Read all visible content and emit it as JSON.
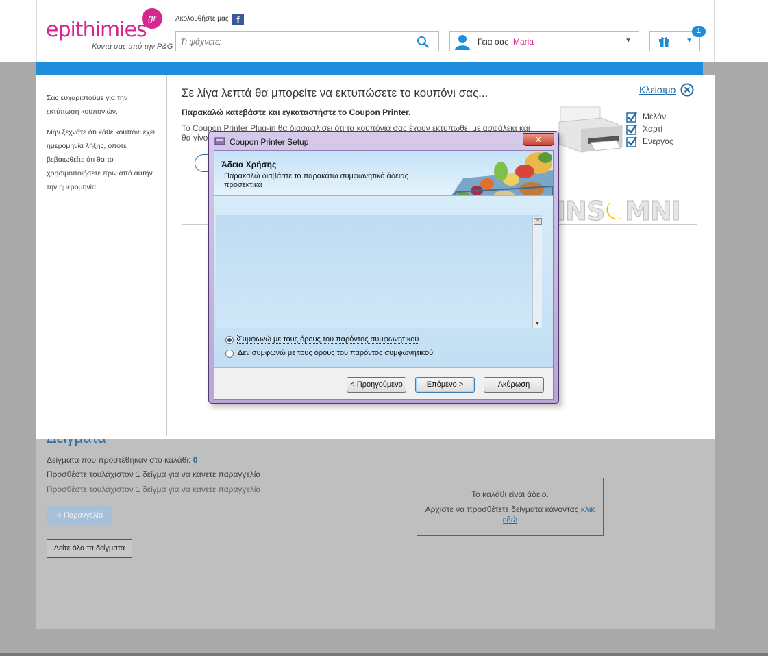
{
  "header": {
    "logo_text": "epithimies",
    "logo_badge": "gr",
    "logo_tagline": "Κοντά σας από την P&G",
    "follow_text": "Ακολουθήστε μας",
    "facebook_glyph": "f",
    "search_placeholder": "Τι ψάχνετε;",
    "greeting": "Γεια σας",
    "user_name": "Maria",
    "gift_count": "1",
    "accent_color": "#d6268f",
    "brand_blue": "#1e8ddc"
  },
  "coupon_panel": {
    "sidebar_thanks": "Σας ευχαριστούμε για την εκτύπωση κουπονιών.",
    "sidebar_reminder": "Μην ξεχνάτε ότι κάθε κουπόνι έχει ημερομηνία λήξης, οπότε βεβαιωθείτε ότι θα το χρησιμοποιήσετε πριν από αυτήν την ημερομηνία.",
    "title": "Σε λίγα λεπτά θα μπορείτε να εκτυπώσετε το κουπόνι σας...",
    "subtitle": "Παρακαλώ κατεβάστε και εγκαταστήστε το Coupon Printer.",
    "description": "Το Coupon Printer Plug-in θα διασφαλίσει ότι τα κουπόνια σας έχουν εκτυπωθεί με ασφάλεια και θα γίνο",
    "close_label": "Κλείσιμο",
    "status_items": [
      "Μελάνι",
      "Χαρτί",
      "Ενεργός"
    ]
  },
  "background_page": {
    "samples_title": "Δείγματα",
    "samples_added_label": "Δείγματα που προστέθηκαν στο καλάθι:",
    "samples_added_count": "0",
    "samples_hint": "Προσθέστε τουλάχιστον 1 δείγμα για να κάνετε παραγγελία",
    "order_button": "➔ Παραγγελία",
    "see_all_button": "Δείτε όλα τα δείγματα",
    "cart_empty": "Το καλάθι είναι άδειο.",
    "cart_start": "Αρχίστε να προσθέτετε δείγματα κάνοντας",
    "cart_link": "κλικ εδώ"
  },
  "dialog": {
    "title": "Coupon Printer Setup",
    "close_glyph": "✕",
    "header_title": "Άδεια Χρήσης",
    "header_subtitle": "Παρακαλώ διαβάστε το παρακάτω συμφωνητικό άδειας προσεκτικά",
    "license_text": "",
    "radio_accept": "Συμφωνώ με τους όρους του παρόντος συμφωνητικού",
    "radio_decline": "Δεν συμφωνώ με τους όρους του παρόντος συμφωνητικού",
    "selected_option": "accept",
    "btn_back": "< Προηγούμενο",
    "btn_next": "Επόμενο >",
    "btn_cancel": "Ακύρωση"
  }
}
